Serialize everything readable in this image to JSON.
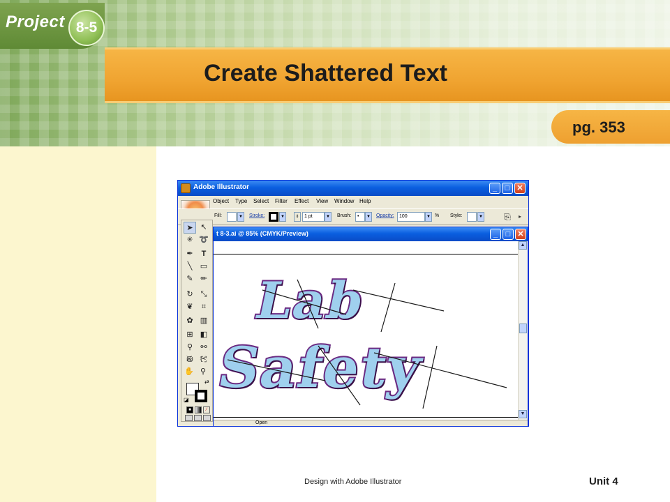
{
  "slide": {
    "project_label": "Project",
    "project_number": "8-5",
    "title": "Create Shattered Text",
    "page_ref": "pg. 353",
    "footer_center": "Design with Adobe Illustrator",
    "footer_right": "Unit 4"
  },
  "app": {
    "window_title": "Adobe Illustrator",
    "menu": [
      "Object",
      "Type",
      "Select",
      "Filter",
      "Effect",
      "View",
      "Window",
      "Help"
    ],
    "control_bar": {
      "fill_label": "Fill:",
      "stroke_label": "Stroke:",
      "stroke_weight": "1 pt",
      "brush_label": "Brush:",
      "brush_value": "•",
      "opacity_label": "Opacity:",
      "opacity_value": "100",
      "opacity_unit": "%",
      "style_label": "Style:"
    },
    "document": {
      "title": "t 8-3.ai @ 85% (CMYK/Preview)",
      "artwork_line1": "Lab",
      "artwork_line2": "Safety",
      "status_text": "Open"
    }
  }
}
